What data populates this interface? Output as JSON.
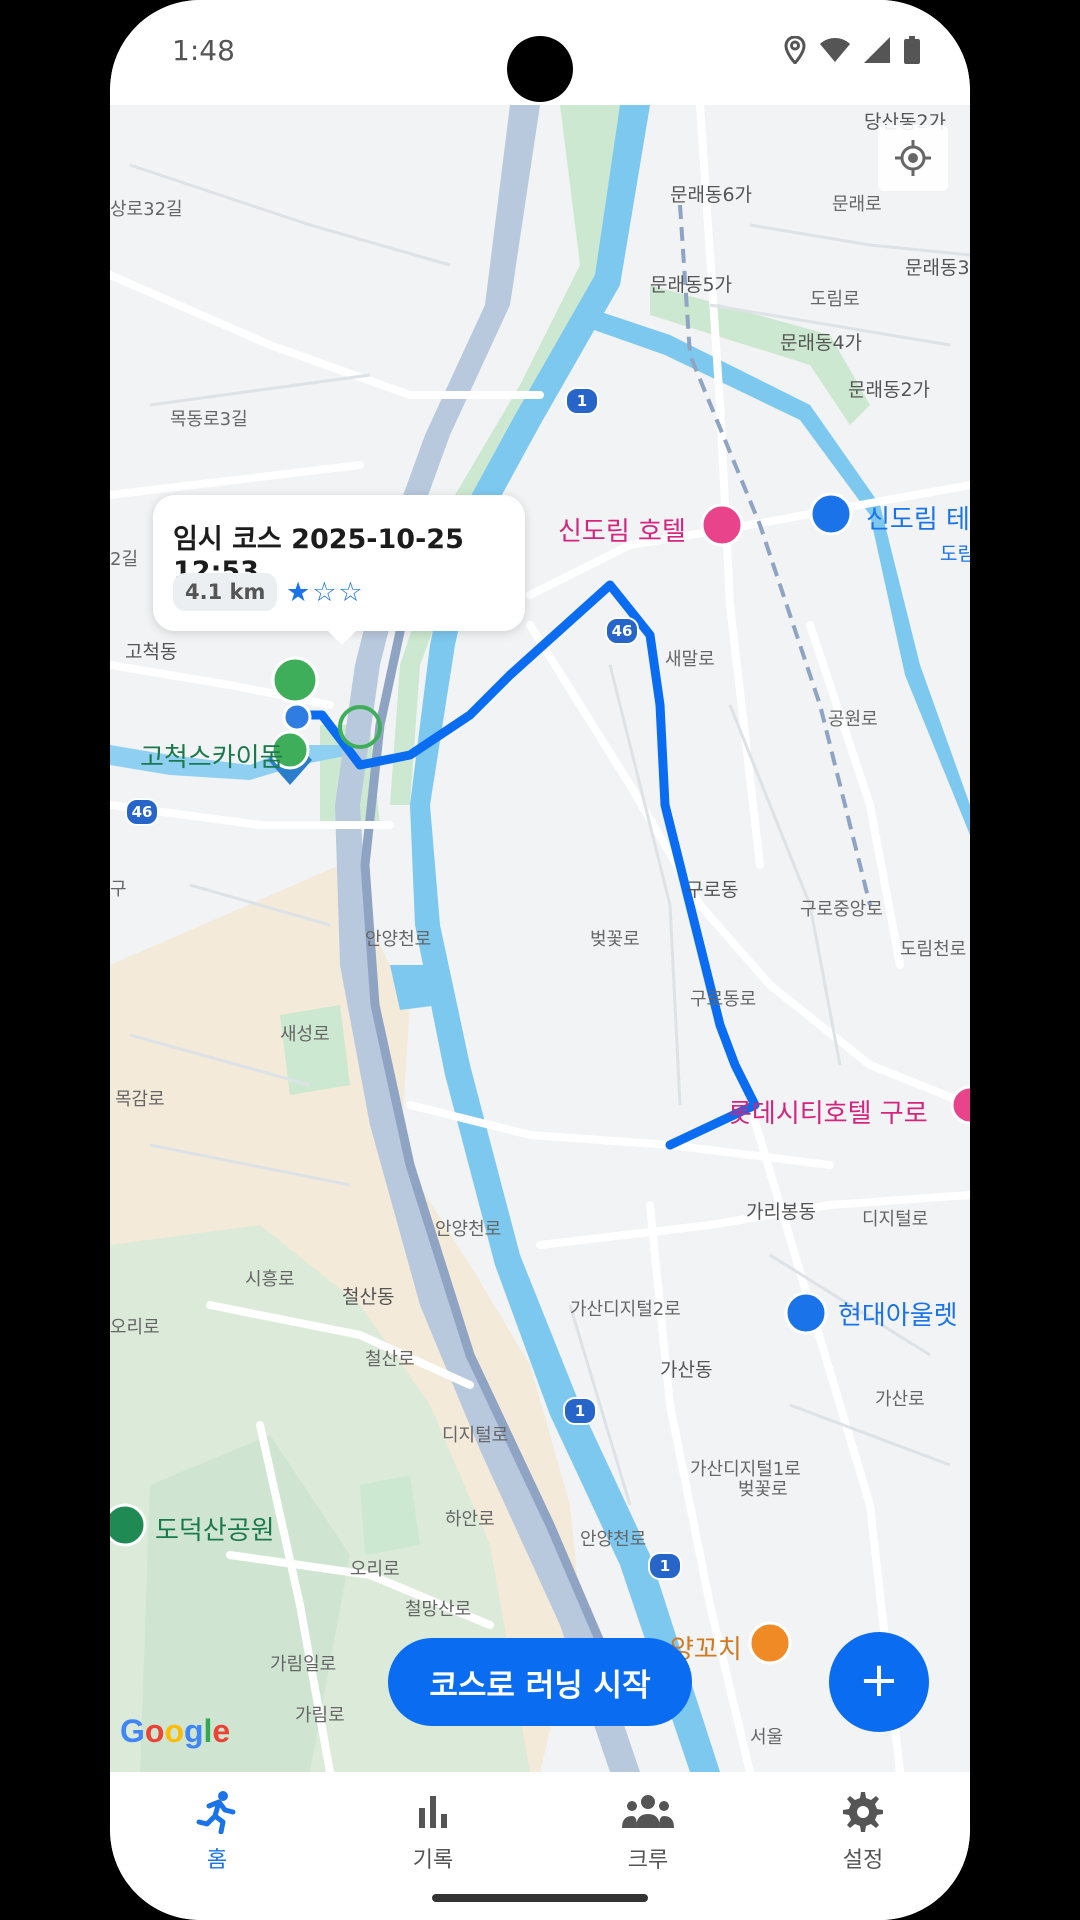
{
  "status_bar": {
    "time": "1:48"
  },
  "map": {
    "labels": {
      "dangsan": "당산동2가",
      "mullae6": "문래동6가",
      "mullaero": "문래로",
      "mullae5": "문래동5가",
      "dorimro": "도림로",
      "mullae3": "문래동3",
      "mullae4": "문래동4가",
      "mullae2": "문래동2가",
      "mokdongro32": "상로32길",
      "mokdongro3": "목동로3길",
      "gocheok": "고척동",
      "gocheok_sky": "고척스카이돔",
      "sindorim_hotel": "신도림 호텔",
      "sindorim_te": "신도림 테",
      "dorim_right": "도림",
      "saemallo": "새말로",
      "gongwonro": "공원로",
      "gurodong": "구로동",
      "gurodongro": "구로동로",
      "gurojungangro": "구로중앙로",
      "dorimcheonro": "도림천로",
      "beotkkotro1": "벚꽃로",
      "anyangcheonro1": "안양천로",
      "lotte_city_hotel": "롯데시티호텔 구로",
      "garibong": "가리봉동",
      "digital_ro": "디지털로",
      "hyundai_outlet": "현대아울렛",
      "gasan_digital2": "가산디지털2로",
      "gasandong": "가산동",
      "cheolsandong": "철산동",
      "cheolsanro": "철산로",
      "digital_ro2": "디지털로",
      "gasan_digital1": "가산디지털1로",
      "beotkkotro2": "벚꽃로",
      "gasanro": "가산로",
      "dodeoksan_park": "도덕산공원",
      "haanro": "하안로",
      "orirro": "오리로",
      "cheolmangsanro": "철망산로",
      "anyangcheonro2": "안양천로",
      "anyangcheonro3": "안양천로",
      "yangkkochi": "양꼬치",
      "garimilro": "가림일로",
      "garimro": "가림로",
      "mokgamro": "목감로",
      "saeseongro": "새성로",
      "sihungro": "시흥로",
      "orirro2": "오리로",
      "seoul": "서울",
      "gu": "구",
      "gil": "2길"
    },
    "shields": {
      "r1a": "1",
      "r46a": "46",
      "r46b": "46",
      "r1b": "1",
      "r1c": "1"
    },
    "google_logo": "Google"
  },
  "course_popup": {
    "title": "임시 코스 2025-10-25 12:53",
    "distance": "4.1 km",
    "rating_stars": "★☆☆",
    "rating": 1,
    "rating_max": 3
  },
  "actions": {
    "start_course_run": "코스로 러닝 시작",
    "add_icon": "+"
  },
  "bottom_nav": {
    "items": [
      {
        "label": "홈",
        "icon": "running-icon",
        "active": true
      },
      {
        "label": "기록",
        "icon": "bar-chart-icon",
        "active": false
      },
      {
        "label": "크루",
        "icon": "group-icon",
        "active": false
      },
      {
        "label": "설정",
        "icon": "gear-icon",
        "active": false
      }
    ]
  },
  "colors": {
    "accent": "#0a6cf0",
    "route": "#0a6cf0",
    "poi_pink": "#d5247e",
    "poi_blue": "#1a73e8",
    "poi_green": "#1a7a4c",
    "river": "#7cc8ef",
    "park": "#cde8d0",
    "highway": "#8fa3c3"
  }
}
